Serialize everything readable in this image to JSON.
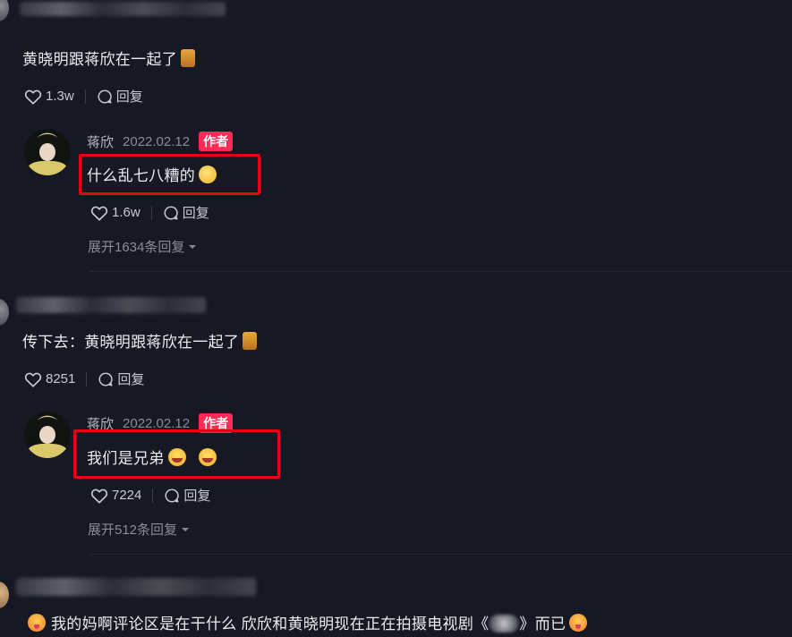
{
  "comments": [
    {
      "text": "黄晓明跟蒋欣在一起了",
      "likes": "1.3w",
      "reply_label": "回复",
      "reply": {
        "author": "蒋欣",
        "date": "2022.02.12",
        "badge": "作者",
        "text": "什么乱七八糟的",
        "likes": "1.6w",
        "reply_label": "回复",
        "expand_label": "展开1634条回复"
      }
    },
    {
      "text": "传下去：黄晓明跟蒋欣在一起了",
      "likes": "8251",
      "reply_label": "回复",
      "reply": {
        "author": "蒋欣",
        "date": "2022.02.12",
        "badge": "作者",
        "text": "我们是兄弟",
        "likes": "7224",
        "reply_label": "回复",
        "expand_label": "展开512条回复"
      }
    },
    {
      "text_a": "我的妈啊评论区是在干什么 欣欣和黄晓明现在正在拍摄电视剧《",
      "text_b": "》而已"
    }
  ],
  "colors": {
    "background": "#161823",
    "badge": "#fe2c55",
    "highlight": "#e60012"
  },
  "icons": [
    "heart-icon",
    "comment-bubble-icon",
    "chevron-down-icon"
  ]
}
